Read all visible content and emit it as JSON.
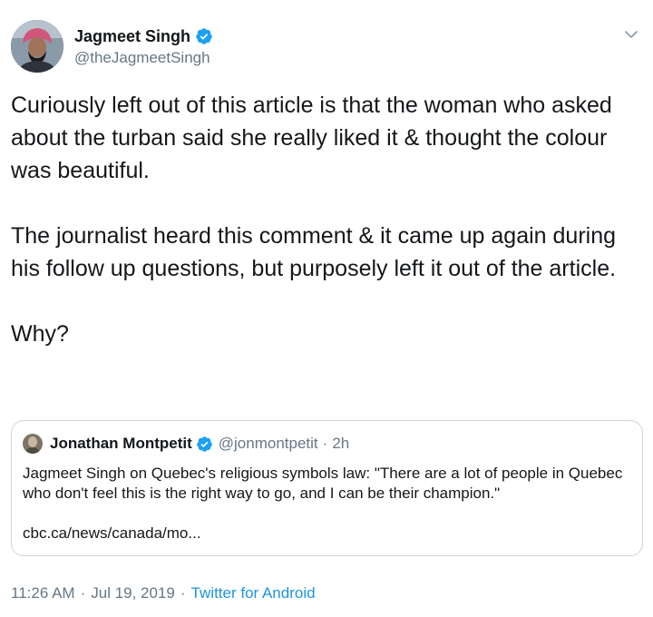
{
  "tweet": {
    "author": {
      "display_name": "Jagmeet Singh",
      "handle": "@theJagmeetSingh",
      "verified": true
    },
    "paragraphs": [
      "Curiously left out of this article is that the woman who asked about the turban said she really liked it & thought the colour was beautiful.",
      "The journalist heard this comment & it came up again during his follow up questions, but purposely left it out of the article.",
      "Why?"
    ],
    "quoted": {
      "display_name": "Jonathan Montpetit",
      "handle": "@jonmontpetit",
      "separator": "·",
      "time": "2h",
      "verified": true,
      "text": "Jagmeet Singh on Quebec's religious symbols law: \"There are a lot of people in Quebec who don't feel this is the right way to go, and I can be their champion.\"",
      "link": "cbc.ca/news/canada/mo..."
    },
    "footer": {
      "time": "11:26 AM",
      "separator": "·",
      "date": "Jul 19, 2019",
      "source": "Twitter for Android"
    }
  },
  "icons": {
    "menu": "chevron-down-icon",
    "verified": "verified-badge-icon"
  },
  "colors": {
    "text": "#14171a",
    "secondary": "#657786",
    "link": "#1b95e0",
    "border": "#ccd6dd",
    "verified": "#1da1f2"
  }
}
